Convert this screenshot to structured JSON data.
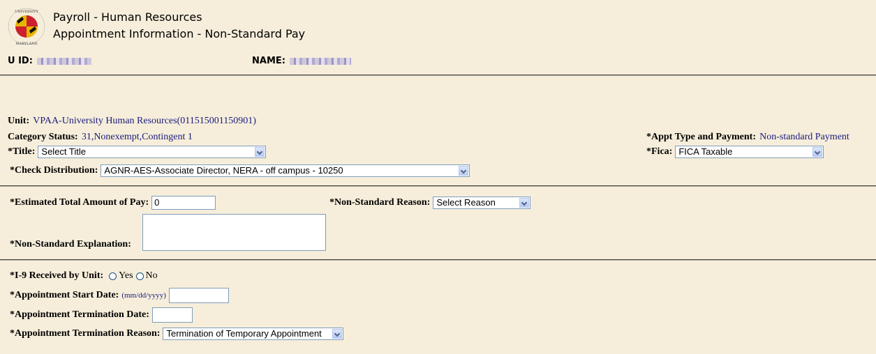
{
  "header": {
    "logo": "university-of-maryland-seal",
    "title_line1": "Payroll - Human Resources",
    "title_line2": "Appointment Information - Non-Standard Pay",
    "uid_label": "U ID:",
    "uid_value": "(redacted)",
    "name_label": "NAME:",
    "name_value": "(redacted)"
  },
  "info": {
    "unit_label": "Unit:",
    "unit_value": "VPAA-University Human Resources(011515001150901)",
    "category_label": "Category Status:",
    "category_value": "31,Nonexempt,Contingent 1",
    "appt_type_label": "*Appt Type and Payment:",
    "appt_type_value": "Non-standard Payment",
    "title_label": "*Title:",
    "title_selected": "Select Title",
    "fica_label": "*Fica:",
    "fica_selected": "FICA Taxable",
    "check_dist_label": "*Check Distribution:",
    "check_dist_selected": "AGNR-AES-Associate Director, NERA - off campus - 10250"
  },
  "pay": {
    "est_total_label": "*Estimated Total Amount of Pay:",
    "est_total_value": "0",
    "reason_label": "*Non-Standard Reason:",
    "reason_selected": "Select Reason",
    "explanation_label": "*Non-Standard Explanation:",
    "explanation_value": ""
  },
  "appointment": {
    "i9_label": "*I-9 Received by Unit:",
    "i9_options": [
      "Yes",
      "No"
    ],
    "start_label": "*Appointment Start Date:",
    "start_hint": "(mm/dd/yyyy)",
    "start_value": "",
    "term_date_label": "*Appointment Termination Date:",
    "term_date_value": "",
    "term_reason_label": "*Appointment Termination Reason:",
    "term_reason_selected": "Termination of Temporary Appointment"
  },
  "colors": {
    "background": "#f6eedb",
    "value_text": "#1a1a7a",
    "input_border": "#7f9db9"
  }
}
